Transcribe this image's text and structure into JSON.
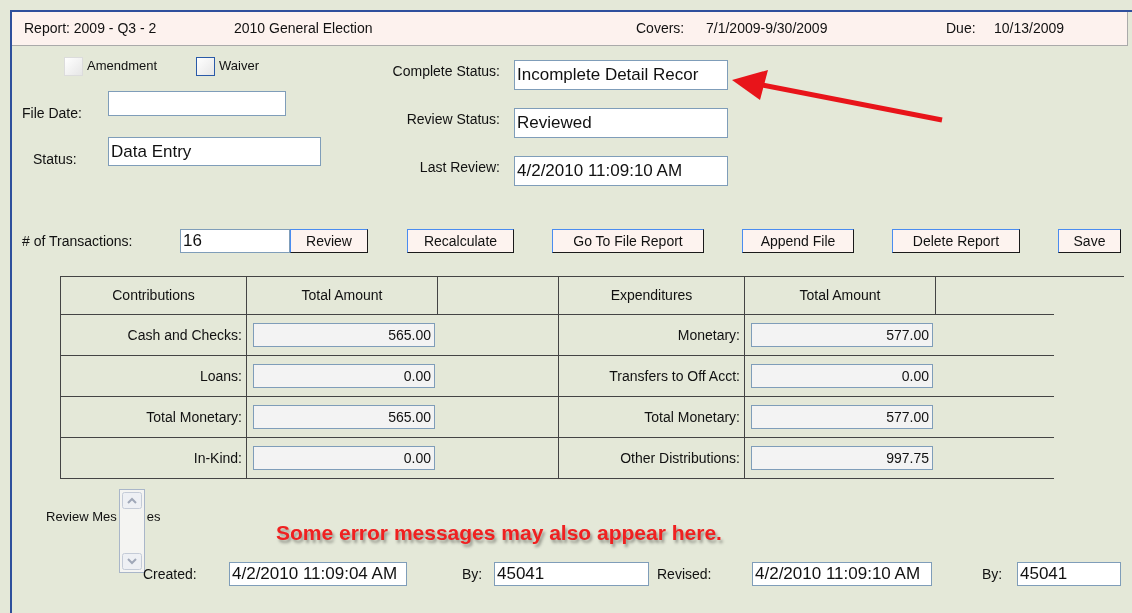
{
  "header": {
    "report": "Report: 2009 - Q3 - 2",
    "election": "2010 General Election",
    "covers_label": "Covers:",
    "covers": "7/1/2009-9/30/2009",
    "due_label": "Due:",
    "due": "10/13/2009"
  },
  "checkboxes": [
    {
      "label": "Amendment",
      "checked": false,
      "focused": false
    },
    {
      "label": "Waiver",
      "checked": false,
      "focused": true
    }
  ],
  "left_fields": [
    {
      "label": "File Date:"
    },
    {
      "label": "Status:",
      "value": "Data Entry"
    }
  ],
  "status_fields": [
    {
      "label": "Complete Status:",
      "value": "Incomplete Detail Recor"
    },
    {
      "label": "Review Status:",
      "value": "Reviewed"
    },
    {
      "label": "Last Review:",
      "value": "4/2/2010 11:09:10 AM"
    }
  ],
  "transactions": {
    "label": "# of Transactions:",
    "value": "16",
    "button": "Review"
  },
  "buttons": [
    "Recalculate",
    "Go To File Report",
    "Append File",
    "Delete Report",
    "Save"
  ],
  "totals": [
    {
      "headers": [
        "Contributions",
        "Total Amount"
      ],
      "rows": [
        {
          "label": "Cash and Checks:",
          "value": "565.00"
        },
        {
          "label": "Loans:",
          "value": "0.00"
        },
        {
          "label": "Total Monetary:",
          "value": "565.00"
        },
        {
          "label": "In-Kind:",
          "value": "0.00"
        }
      ]
    },
    {
      "headers": [
        "Expenditures",
        "Total Amount"
      ],
      "rows": [
        {
          "label": "Monetary:",
          "value": "577.00"
        },
        {
          "label": "Transfers to Off Acct:",
          "value": "0.00"
        },
        {
          "label": "Total Monetary:",
          "value": "577.00"
        },
        {
          "label": "Other Distributions:",
          "value": "997.75"
        }
      ]
    }
  ],
  "review_messages": {
    "label_parts": [
      "Review Mes",
      "es"
    ]
  },
  "annotation": {
    "text": "Some error messages may also appear here."
  },
  "footer": [
    {
      "label": "Created:",
      "value": "4/2/2010 11:09:04 AM"
    },
    {
      "label": "By:",
      "value": "45041"
    },
    {
      "label": "Revised:",
      "value": "4/2/2010 11:09:10 AM"
    },
    {
      "label": "By:",
      "value": "45041"
    }
  ]
}
